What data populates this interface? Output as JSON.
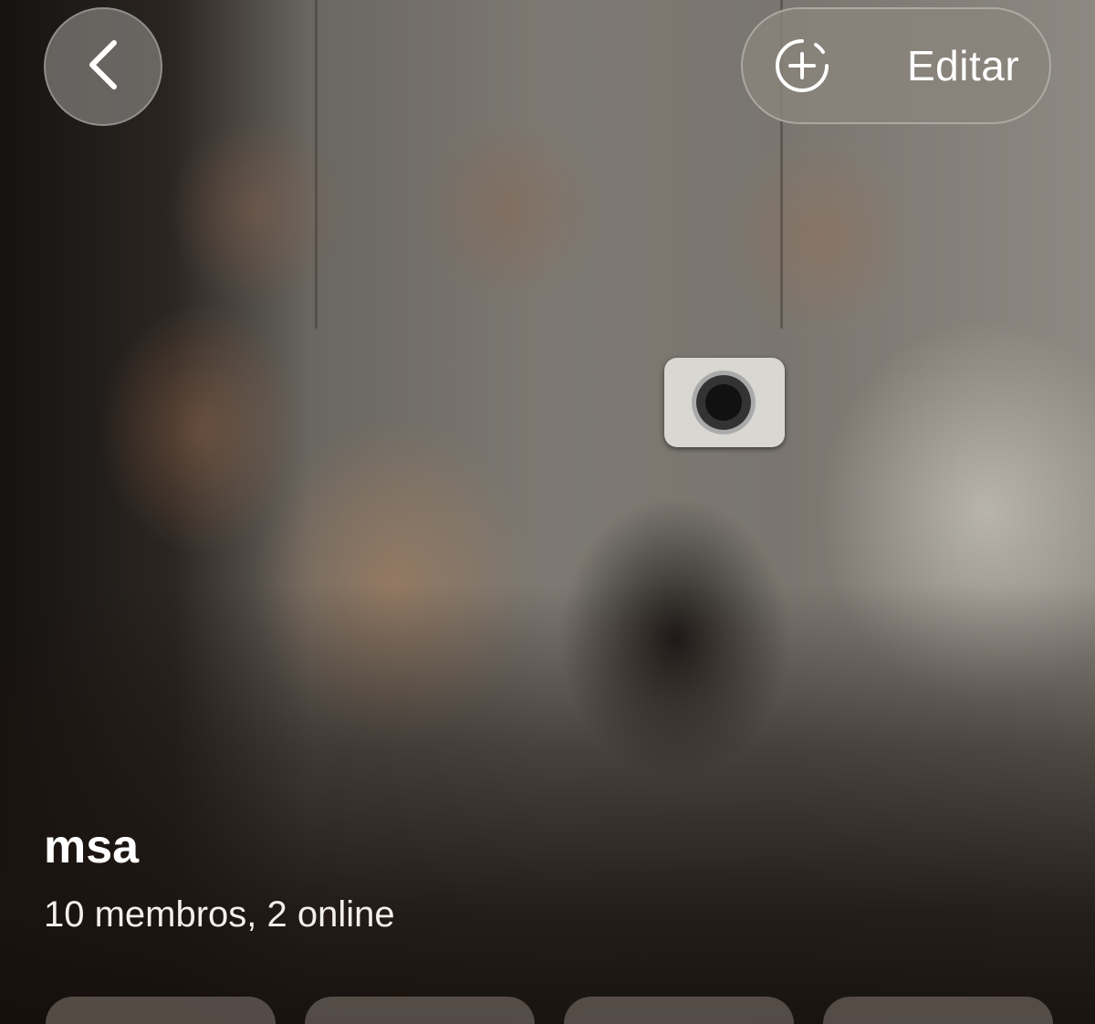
{
  "header": {
    "back_icon": "chevron-left-icon",
    "edit_icon": "add-photo-icon",
    "edit_label": "Editar"
  },
  "group": {
    "name": "msa",
    "meta": "10 membros, 2 online"
  },
  "actions": {
    "count": 4
  },
  "colors": {
    "overlay_button": "#7c7874",
    "text": "#ffffff"
  }
}
